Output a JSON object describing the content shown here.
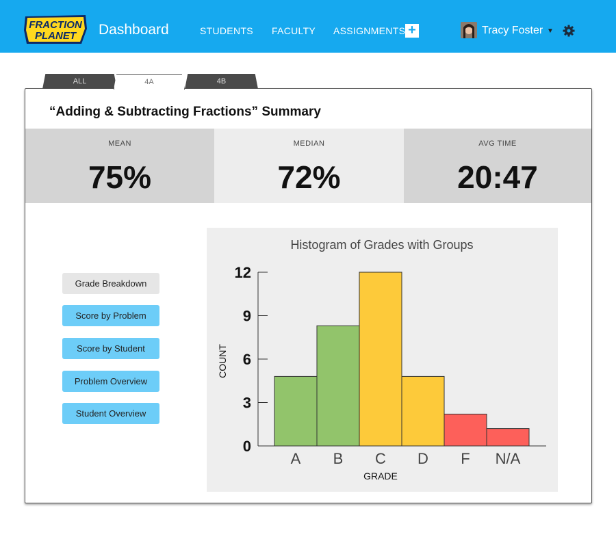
{
  "header": {
    "logo_text_line1": "FRACTION",
    "logo_text_line2": "PLANET",
    "title": "Dashboard",
    "nav": [
      "STUDENTS",
      "FACULTY",
      "ASSIGNMENTS"
    ],
    "add_icon": "plus-icon",
    "user_name": "Tracy Foster",
    "caret_icon": "caret-down-icon",
    "settings_icon": "gear-icon"
  },
  "tabs": [
    {
      "label": "ALL",
      "active": false
    },
    {
      "label": "4A",
      "active": true
    },
    {
      "label": "4B",
      "active": false
    }
  ],
  "summary": {
    "title": "“Adding & Subtracting Fractions” Summary",
    "stats": [
      {
        "label": "MEAN",
        "value": "75%"
      },
      {
        "label": "MEDIAN",
        "value": "72%"
      },
      {
        "label": "AVG TIME",
        "value": "20:47"
      }
    ]
  },
  "sidebar": {
    "buttons": [
      {
        "label": "Grade Breakdown",
        "active": true
      },
      {
        "label": "Score by Problem",
        "active": false
      },
      {
        "label": "Score by Student",
        "active": false
      },
      {
        "label": "Problem Overview",
        "active": false
      },
      {
        "label": "Student Overview",
        "active": false
      }
    ]
  },
  "colors": {
    "topbar": "#16a9ef",
    "green": "#92c46b",
    "yellow": "#fdca3a",
    "red": "#fd605a"
  },
  "chart_data": {
    "type": "bar",
    "title": "Histogram of Grades with Groups",
    "xlabel": "GRADE",
    "ylabel": "COUNT",
    "categories": [
      "A",
      "B",
      "C",
      "D",
      "F",
      "N/A"
    ],
    "values": [
      4.8,
      8.3,
      12,
      4.8,
      2.2,
      1.2
    ],
    "bar_colors": [
      "#92c46b",
      "#92c46b",
      "#fdca3a",
      "#fdca3a",
      "#fd605a",
      "#fd605a"
    ],
    "ylim": [
      0,
      12
    ],
    "yticks": [
      0,
      3,
      6,
      9,
      12
    ]
  }
}
